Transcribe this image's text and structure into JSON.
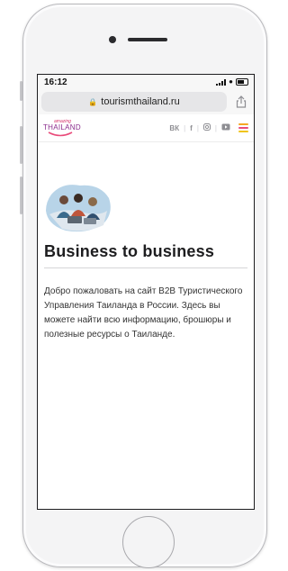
{
  "status_bar": {
    "time": "16:12"
  },
  "browser": {
    "url": "tourismthailand.ru"
  },
  "site": {
    "logo": {
      "top": "amazing",
      "main": "THAILAND"
    },
    "social": [
      "vk-icon",
      "facebook-icon",
      "instagram-icon",
      "youtube-icon"
    ],
    "menu_colors": [
      "#f5a623",
      "#e94b7a",
      "#f0c419"
    ]
  },
  "content": {
    "title": "Business to business",
    "intro": "Добро пожаловать на сайт B2B Туристического Управления Таиланда в России. Здесь вы можете найти всю информацию, брошюры и полезные ресурсы о Таиланде."
  },
  "colors": {
    "brand_purple": "#8a2b8c",
    "brand_pink": "#d6336c"
  }
}
